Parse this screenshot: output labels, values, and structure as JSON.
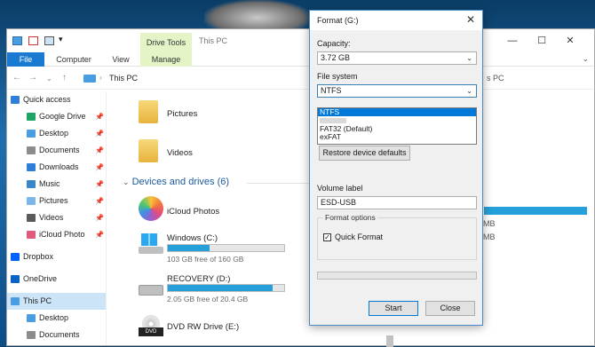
{
  "explorer": {
    "title": "This PC",
    "context_tab": "Drive Tools",
    "ribbon_tabs": [
      "File",
      "Computer",
      "View",
      "Manage"
    ],
    "window_controls": [
      "—",
      "☐",
      "✕"
    ],
    "address": {
      "crumb": "This PC",
      "search_fragment": "s PC"
    },
    "nav": [
      {
        "label": "Quick access",
        "top": true,
        "icon": "star-icon",
        "color": "#2f7fd6"
      },
      {
        "label": "Google Drive",
        "icon": "google-drive-icon",
        "color": "#1fa463",
        "pinned": true
      },
      {
        "label": "Desktop",
        "icon": "desktop-icon",
        "color": "#4a9de0",
        "pinned": true
      },
      {
        "label": "Documents",
        "icon": "documents-icon",
        "color": "#8c8c8c",
        "pinned": true
      },
      {
        "label": "Downloads",
        "icon": "downloads-icon",
        "color": "#2f7fd6",
        "pinned": true
      },
      {
        "label": "Music",
        "icon": "music-icon",
        "color": "#3a86c8",
        "pinned": true
      },
      {
        "label": "Pictures",
        "icon": "pictures-icon",
        "color": "#7db6e8",
        "pinned": true
      },
      {
        "label": "Videos",
        "icon": "videos-icon",
        "color": "#5a5a5a",
        "pinned": true
      },
      {
        "label": "iCloud Photo",
        "icon": "icloud-photo-icon",
        "color": "#e05a7a",
        "pinned": true
      },
      {
        "label": "Dropbox",
        "top": true,
        "icon": "dropbox-icon",
        "color": "#0061fe"
      },
      {
        "label": "OneDrive",
        "top": true,
        "icon": "onedrive-icon",
        "color": "#0a64c8"
      },
      {
        "label": "This PC",
        "top": true,
        "icon": "this-pc-icon",
        "color": "#4a9de0",
        "selected": true
      },
      {
        "label": "Desktop",
        "icon": "desktop-icon",
        "color": "#4a9de0"
      },
      {
        "label": "Documents",
        "icon": "documents-icon",
        "color": "#8c8c8c"
      }
    ],
    "folders": [
      "Pictures",
      "Videos"
    ],
    "section_title": "Devices and drives (6)",
    "drives": [
      {
        "name": "iCloud Photos",
        "icon": "icloud-photos-icon"
      },
      {
        "name": "Windows (C:)",
        "free": "103 GB free of 160 GB",
        "used_fraction": 0.36,
        "icon": "windows-drive-icon"
      },
      {
        "name": "RECOVERY (D:)",
        "free": "2.05 GB free of 20.4 GB",
        "used_fraction": 0.9,
        "icon": "hard-drive-icon"
      },
      {
        "name": "DVD RW Drive (E:)",
        "icon": "dvd-drive-icon"
      }
    ],
    "right_fragments": [
      "MB",
      "MB"
    ]
  },
  "dialog": {
    "title": "Format  (G:)",
    "capacity_label": "Capacity:",
    "capacity_value": "3.72 GB",
    "filesystem_label": "File system",
    "filesystem_value": "NTFS",
    "filesystem_options": [
      "NTFS",
      "",
      "FAT32 (Default)",
      "exFAT"
    ],
    "restore_label": "Restore device defaults",
    "volume_label_label": "Volume label",
    "volume_label_value": "ESD-USB",
    "format_options_label": "Format options",
    "quick_format_label": "Quick Format",
    "quick_format_checked": true,
    "start_label": "Start",
    "close_label": "Close"
  }
}
